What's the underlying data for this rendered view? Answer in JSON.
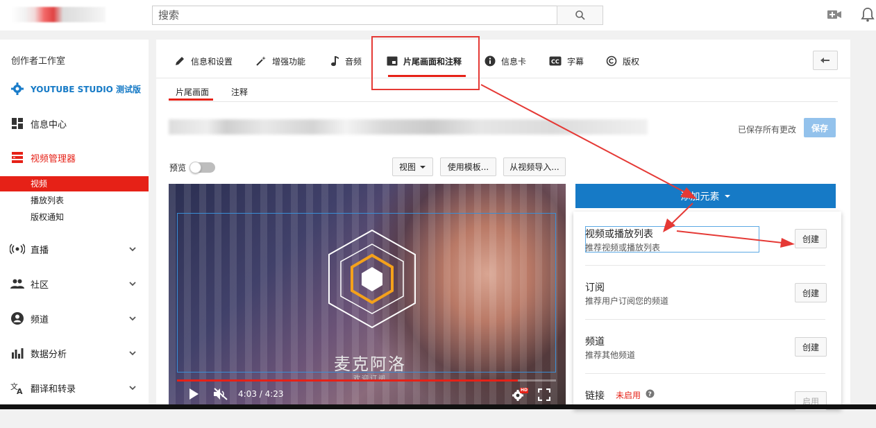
{
  "header": {
    "search_placeholder": "搜索",
    "icons": {
      "search": "search-icon",
      "upload": "video-camera-plus-icon",
      "notifications": "bell-icon"
    }
  },
  "sidebar": {
    "title": "创作者工作室",
    "studio_label": "YOUTUBE STUDIO 测试版",
    "items": [
      {
        "label": "信息中心",
        "icon": "dashboard-icon"
      },
      {
        "label": "视频管理器",
        "icon": "video-manager-icon",
        "active": true
      },
      {
        "label": "直播",
        "icon": "live-icon"
      },
      {
        "label": "社区",
        "icon": "community-icon"
      },
      {
        "label": "频道",
        "icon": "channel-icon"
      },
      {
        "label": "数据分析",
        "icon": "analytics-icon"
      },
      {
        "label": "翻译和转录",
        "icon": "translate-icon"
      }
    ],
    "sub_items": [
      {
        "label": "视频",
        "active": true
      },
      {
        "label": "播放列表"
      },
      {
        "label": "版权通知"
      }
    ]
  },
  "tabs": [
    {
      "label": "信息和设置",
      "icon": "pencil-icon"
    },
    {
      "label": "增强功能",
      "icon": "magic-wand-icon"
    },
    {
      "label": "音频",
      "icon": "music-note-icon"
    },
    {
      "label": "片尾画面和注释",
      "icon": "end-screen-icon",
      "active": true
    },
    {
      "label": "信息卡",
      "icon": "info-icon"
    },
    {
      "label": "字幕",
      "icon": "cc-icon"
    },
    {
      "label": "版权",
      "icon": "copyright-icon"
    }
  ],
  "subtabs": [
    {
      "label": "片尾画面",
      "active": true
    },
    {
      "label": "注释"
    }
  ],
  "save": {
    "status": "已保存所有更改",
    "button": "保存"
  },
  "toolbar": {
    "preview_label": "预览",
    "preview_on": false,
    "view_label": "视图",
    "template_label": "使用模板...",
    "import_label": "从视频导入..."
  },
  "video": {
    "brand_text": "麦克阿洛",
    "brand_sub": "欢迎订阅",
    "time": "4:03 / 4:23",
    "progress_fraction": 0.9,
    "hd_badge": "HD"
  },
  "add_element": {
    "label": "添加元素"
  },
  "menu_items": [
    {
      "title": "视频或播放列表",
      "desc": "推荐视频或播放列表",
      "button": "创建"
    },
    {
      "title": "订阅",
      "desc": "推荐用户订阅您的频道",
      "button": "创建"
    },
    {
      "title": "频道",
      "desc": "推荐其他频道",
      "button": "创建"
    },
    {
      "title": "链接",
      "status": "未启用",
      "button": "启用"
    }
  ],
  "colors": {
    "accent_red": "#e62117",
    "primary_blue": "#167ac6",
    "save_disabled": "#93c2ec",
    "annotation_red": "#e53935"
  }
}
